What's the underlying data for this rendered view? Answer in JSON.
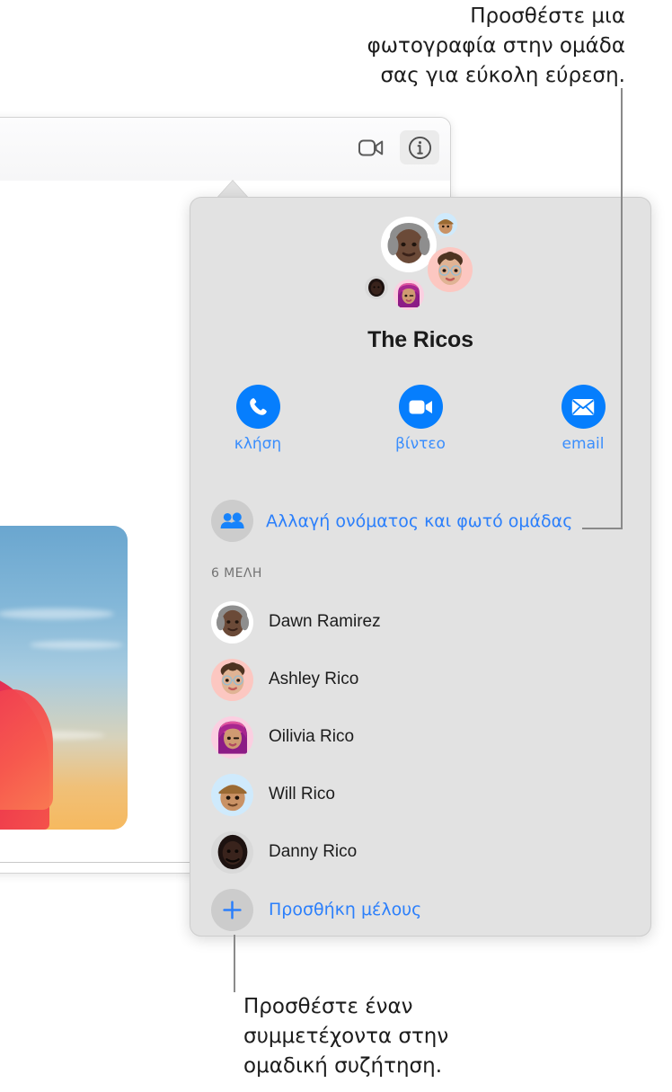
{
  "annotations": {
    "top": "Προσθέστε μια\nφωτογραφία στην ομάδα\nσας για εύκολη εύρεση.",
    "bottom": "Προσθέστε έναν\nσυμμετέχοντα στην\nομαδική συζήτηση."
  },
  "window": {
    "toolbar": {
      "video_button_icon": "video-camera-icon",
      "info_button_icon": "info-circle-icon"
    },
    "message": {
      "attachment_type": "photo"
    }
  },
  "popover": {
    "title": "The Ricos",
    "avatar_cluster": [
      {
        "name": "Dawn Ramirez",
        "bg": "#ffffff"
      },
      {
        "name": "Will Rico",
        "bg": "#cfeafc"
      },
      {
        "name": "Ashley Rico",
        "bg": "#fcc7c1"
      },
      {
        "name": "Danny Rico",
        "bg": "#d9d9d9"
      },
      {
        "name": "Oilivia Rico",
        "bg": "#fbcfe1"
      }
    ],
    "actions": [
      {
        "label": "κλήση",
        "icon": "phone-icon"
      },
      {
        "label": "βίντεο",
        "icon": "video-camera-icon"
      },
      {
        "label": "email",
        "icon": "envelope-icon"
      }
    ],
    "rename": {
      "label": "Αλλαγή ονόματος και φωτό ομάδας",
      "icon": "two-people-icon"
    },
    "members_header": "6 ΜΕΛΗ",
    "members": [
      {
        "name": "Dawn Ramirez",
        "bg": "#ffffff"
      },
      {
        "name": "Ashley Rico",
        "bg": "#fcc7c1"
      },
      {
        "name": "Oilivia Rico",
        "bg": "#fbcfe1"
      },
      {
        "name": "Will Rico",
        "bg": "#cfeafc"
      },
      {
        "name": "Danny Rico",
        "bg": "#d9d9d9"
      }
    ],
    "add_member": {
      "label": "Προσθήκη μέλους",
      "icon": "plus-icon"
    }
  },
  "colors": {
    "accent_blue": "#067efd",
    "link_blue": "#2b7ffb",
    "popover_bg": "#e2e2e2",
    "text_primary": "#1c1c1c",
    "text_secondary": "#737373"
  }
}
